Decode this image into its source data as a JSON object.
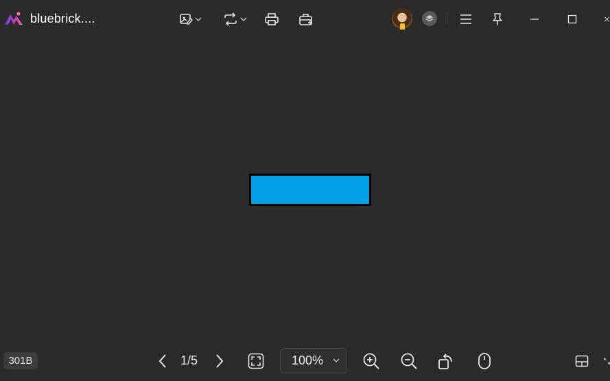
{
  "app": {
    "title": "bluebrick....",
    "brand_colors": [
      "#7b3fe4",
      "#c03fc2",
      "#ff5aa0"
    ]
  },
  "titlebar": {
    "icons": [
      "edit-image-icon",
      "convert-icon",
      "print-icon",
      "toolbox-icon",
      "avatar",
      "extension-icon",
      "menu-icon",
      "pin-icon",
      "minimize-icon",
      "maximize-icon",
      "close-icon"
    ]
  },
  "canvas": {
    "shape_fill": "#00a0e6",
    "shape_border": "#000000"
  },
  "statusbar": {
    "file_size": "301B",
    "page_indicator": "1/5",
    "zoom": "100%"
  }
}
